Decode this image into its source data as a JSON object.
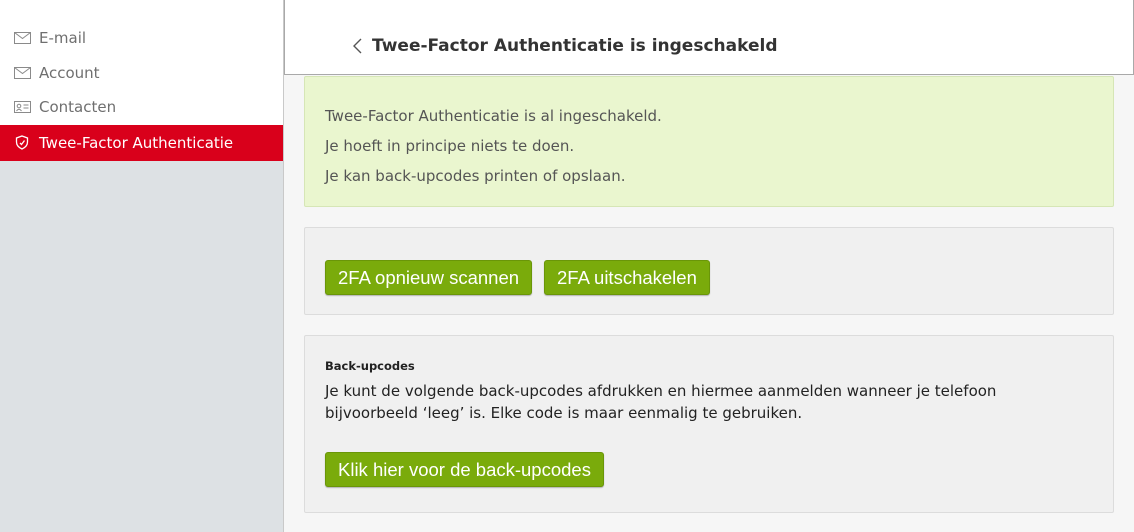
{
  "sidebar": {
    "items": [
      {
        "label": "E-mail",
        "icon": "mail-icon",
        "active": false
      },
      {
        "label": "Account",
        "icon": "mail-icon",
        "active": false
      },
      {
        "label": "Contacten",
        "icon": "contact-card-icon",
        "active": false
      },
      {
        "label": "Twee-Factor Authenticatie",
        "icon": "shield-icon",
        "active": true
      }
    ]
  },
  "header": {
    "title": "Twee-Factor Authenticatie is ingeschakeld",
    "back_icon": "chevron-left-icon"
  },
  "alert": {
    "lines": [
      "Twee-Factor Authenticatie is al ingeschakeld.",
      "Je hoeft in principe niets te doen.",
      "Je kan back-upcodes printen of opslaan."
    ]
  },
  "actions": {
    "rescan_label": "2FA opnieuw scannen",
    "disable_label": "2FA uitschakelen"
  },
  "backup": {
    "heading": "Back-upcodes",
    "description": "Je kunt de volgende back-upcodes afdrukken en hiermee aanmelden wanneer je telefoon bijvoorbeeld ‘leeg’ is. Elke code is maar eenmalig te gebruiken.",
    "button_label": "Klik hier voor de back-upcodes"
  },
  "colors": {
    "accent_red": "#d9001b",
    "button_green": "#7aab0b",
    "alert_bg": "#eaf6cf"
  }
}
